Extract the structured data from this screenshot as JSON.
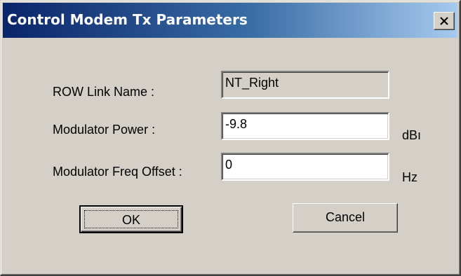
{
  "window": {
    "title": "Control Modem Tx Parameters",
    "close_icon": "close-icon"
  },
  "form": {
    "row_link_name": {
      "label": "ROW Link Name :",
      "value": "NT_Right",
      "editable": false
    },
    "modulator_power": {
      "label": "Modulator Power :",
      "value": "-9.8",
      "unit": "dBı"
    },
    "modulator_freq_offset": {
      "label": "Modulator Freq Offset :",
      "value": "0",
      "unit": "Hz"
    }
  },
  "buttons": {
    "ok_label": "OK",
    "cancel_label": "Cancel"
  },
  "colors": {
    "dialog_face": "#d4d0c8",
    "titlebar_start": "#0a246a",
    "titlebar_end": "#a6caf0",
    "title_text": "#ffffff"
  }
}
